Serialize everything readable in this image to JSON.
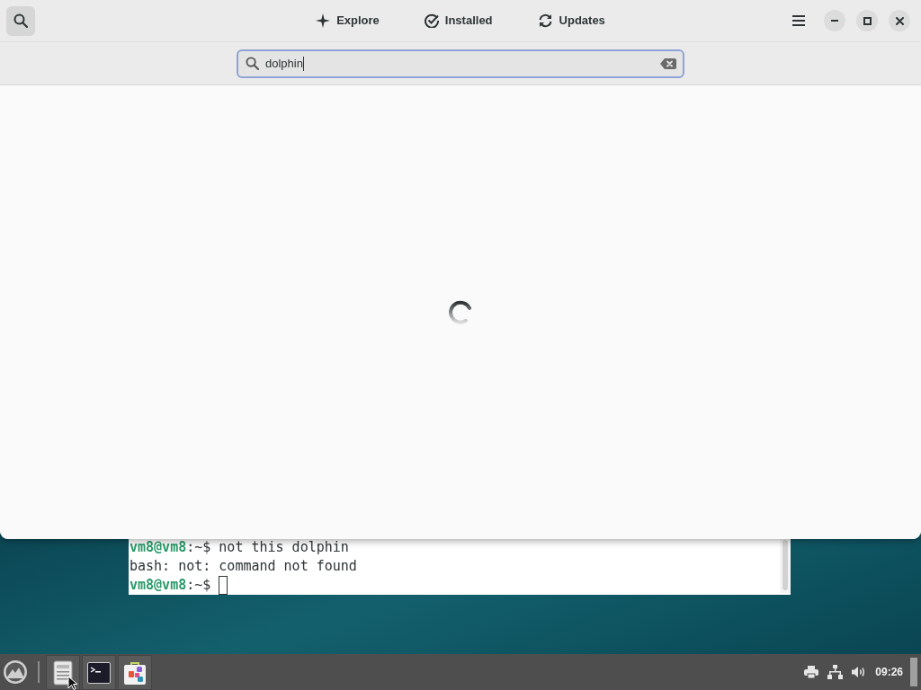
{
  "software_window": {
    "search_toggle": {
      "on": true
    },
    "tabs": [
      {
        "label": "Explore",
        "selected": false
      },
      {
        "label": "Installed",
        "selected": false
      },
      {
        "label": "Updates",
        "selected": false
      }
    ],
    "search": {
      "value": "dolphin"
    }
  },
  "terminal": {
    "lines": [
      {
        "kind": "prompt",
        "user_host": "vm8@vm8",
        "prompt": ":~$",
        "command": "not this dolphin",
        "cursor": false
      },
      {
        "kind": "output",
        "text": "bash: not: command not found",
        "cursor": false
      },
      {
        "kind": "prompt",
        "user_host": "vm8@vm8",
        "prompt": ":~$",
        "cursor": true
      }
    ]
  },
  "taskbar": {
    "clock": "09:26"
  }
}
